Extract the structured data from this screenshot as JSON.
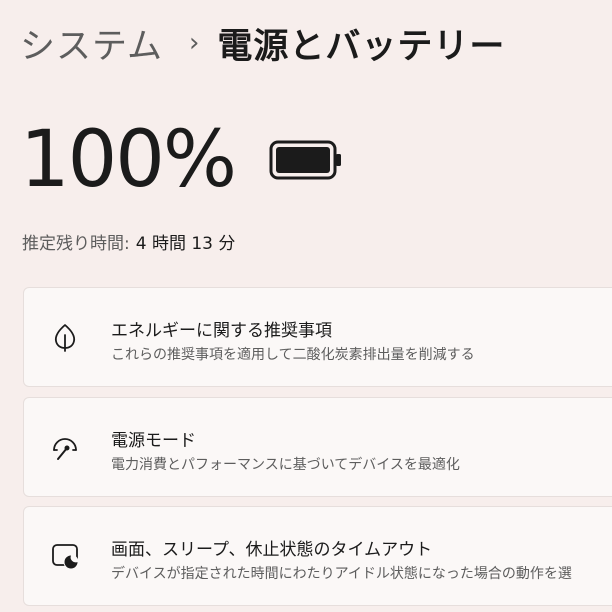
{
  "breadcrumb": {
    "parent": "システム",
    "separator": "›",
    "current": "電源とバッテリー"
  },
  "battery": {
    "percent_text": "100%",
    "level": 1.0,
    "remaining_label": "推定残り時間:",
    "remaining_value": "4 時間 13 分"
  },
  "cards": [
    {
      "icon": "leaf-icon",
      "title": "エネルギーに関する推奨事項",
      "description": "これらの推奨事項を適用して二酸化炭素排出量を削減する"
    },
    {
      "icon": "speedometer-icon",
      "title": "電源モード",
      "description": "電力消費とパフォーマンスに基づいてデバイスを最適化"
    },
    {
      "icon": "sleep-screen-icon",
      "title": "画面、スリープ、休止状態のタイムアウト",
      "description": "デバイスが指定された時間にわたりアイドル状態になった場合の動作を選"
    }
  ],
  "colors": {
    "background": "#f7eeec",
    "card": "#fbf8f7",
    "text_primary": "#1b1b1b",
    "text_secondary": "#5d5d5d"
  }
}
